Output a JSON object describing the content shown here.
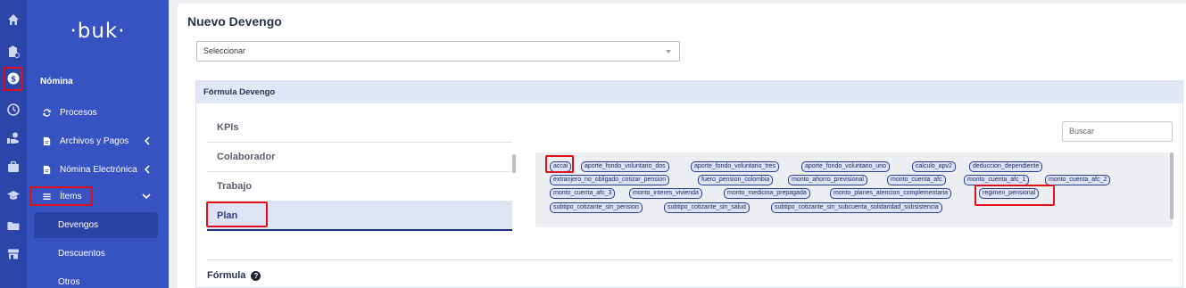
{
  "rail": {
    "icons": [
      "home-icon",
      "clipboard-icon",
      "dollar-icon",
      "clock-icon",
      "hand-money-icon",
      "briefcase-icon",
      "graduation-cap-icon",
      "folder-icon",
      "store-icon"
    ]
  },
  "sidebar": {
    "logo": "·buk·",
    "section_title": "Nómina",
    "items": [
      {
        "label": "Procesos"
      },
      {
        "label": "Archivos y Pagos"
      },
      {
        "label": "Nómina Electrónica"
      },
      {
        "label": "Ítems"
      }
    ],
    "subitems": [
      {
        "label": "Devengos"
      },
      {
        "label": "Descuentos"
      },
      {
        "label": "Otros"
      }
    ]
  },
  "main": {
    "title": "Nuevo Devengo",
    "select_value": "Seleccionar",
    "card_title": "Fórmula Devengo",
    "tabs": [
      {
        "label": "KPIs"
      },
      {
        "label": "Colaborador"
      },
      {
        "label": "Trabajo"
      },
      {
        "label": "Plan"
      }
    ],
    "search_placeholder": "Buscar",
    "variables": [
      "accai",
      "aporte_fondo_voluntario_dos",
      "aporte_fondo_voluntario_tres",
      "aporte_fondo_voluntario_uno",
      "calculo_apv2",
      "deduccion_dependiente",
      "extranjero_no_obligado_cotizar_pension",
      "fuero_pension_colombia",
      "monto_ahorro_previsional",
      "monto_cuenta_afc",
      "monto_cuenta_afc_1",
      "monto_cuenta_afc_2",
      "monto_cuenta_afc_3",
      "monto_interes_vivienda",
      "monto_medicina_prepagada",
      "monto_planes_atencion_complementaria",
      "regimen_pensional",
      "subtipo_cotizante_sin_pension",
      "subtipo_cotizante_sin_salud",
      "subtipo_cotizante_sin_subcuenta_solidaridad_subsistencia"
    ],
    "formula_label": "Fórmula",
    "help_glyph": "?"
  },
  "colors": {
    "rail": "#2b45a8",
    "sidebar": "#3753c2",
    "highlight": "#e0101a",
    "chip_border": "#2a3d8f"
  }
}
